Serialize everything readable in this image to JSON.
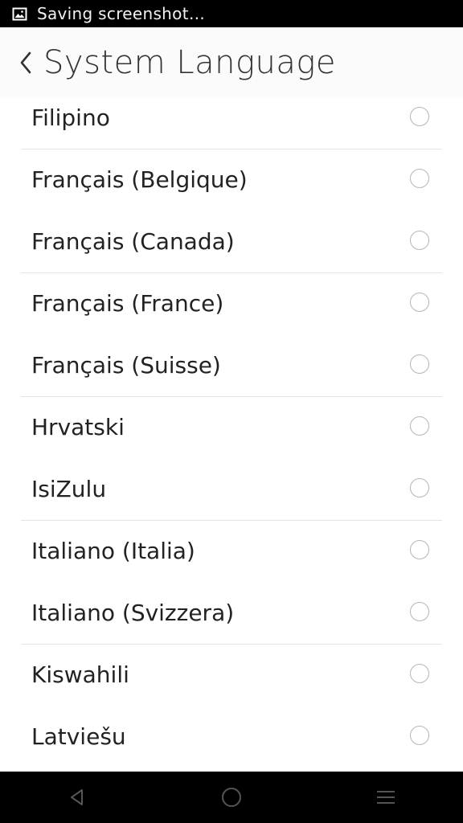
{
  "status_bar": {
    "notification_text": "Saving screenshot…",
    "icon": "image-icon"
  },
  "header": {
    "title": "System Language",
    "back_icon": "chevron-left-icon"
  },
  "languages": [
    {
      "label": "Filipino",
      "selected": false
    },
    {
      "label": "Français (Belgique)",
      "selected": false
    },
    {
      "label": "Français (Canada)",
      "selected": false
    },
    {
      "label": "Français (France)",
      "selected": false
    },
    {
      "label": "Français (Suisse)",
      "selected": false
    },
    {
      "label": "Hrvatski",
      "selected": false
    },
    {
      "label": "IsiZulu",
      "selected": false
    },
    {
      "label": "Italiano (Italia)",
      "selected": false
    },
    {
      "label": "Italiano (Svizzera)",
      "selected": false
    },
    {
      "label": "Kiswahili",
      "selected": false
    },
    {
      "label": "Latviešu",
      "selected": false
    }
  ],
  "nav_bar": {
    "back": "triangle-back-icon",
    "home": "circle-home-icon",
    "menu": "menu-icon"
  },
  "colors": {
    "background": "#ffffff",
    "header_bg": "#fbfbfb",
    "text": "#222222",
    "radio": "#b5b5b5",
    "divider": "#e4e4e4"
  }
}
